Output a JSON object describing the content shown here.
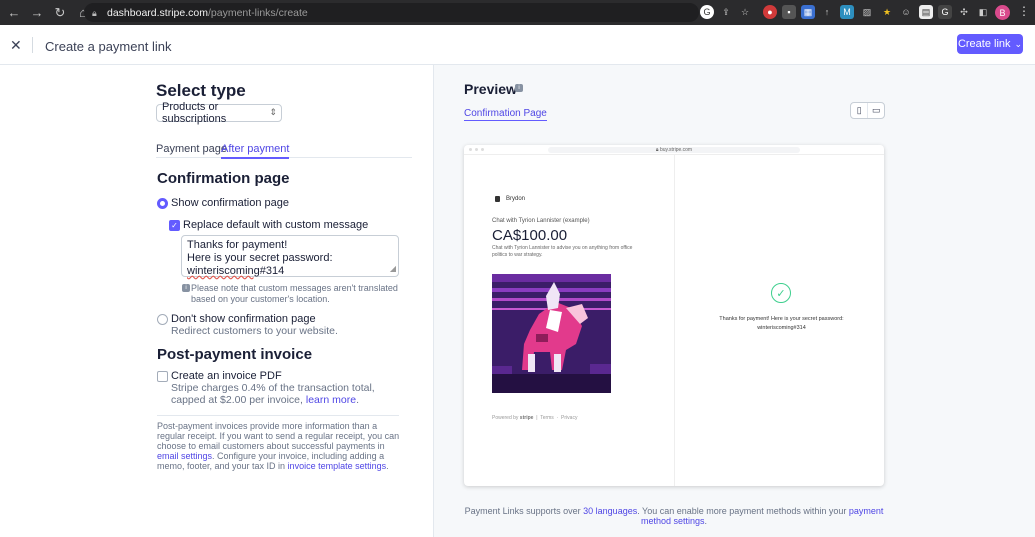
{
  "browser": {
    "url_host": "dashboard.stripe.com",
    "url_path": "/payment-links/create",
    "profile_initial": "B"
  },
  "header": {
    "title": "Create a payment link",
    "create_label": "Create link"
  },
  "left": {
    "select_type_title": "Select type",
    "select_value": "Products or subscriptions",
    "tabs": [
      {
        "label": "Payment page"
      },
      {
        "label": "After payment"
      }
    ],
    "confirmation_title": "Confirmation page",
    "show_confirmation_label": "Show confirmation page",
    "replace_default_label": "Replace default with custom message",
    "message_line1": "Thanks for payment!",
    "message_line2_prefix": "Here is your secret password: ",
    "message_line2_password": "winteriscoming",
    "message_line2_suffix": "#314",
    "note": "Please note that custom messages aren't translated based on your customer's location.",
    "dont_show_label": "Don't show confirmation page",
    "dont_show_sub": "Redirect customers to your website.",
    "post_payment_title": "Post-payment invoice",
    "invoice_pdf_label": "Create an invoice PDF",
    "invoice_pdf_sub": "Stripe charges 0.4% of the transaction total, capped at $2.00 per invoice, ",
    "learn_more": "learn more",
    "footnote_part1": "Post-payment invoices provide more information than a regular receipt. If you want to send a regular receipt, you can choose to email customers about successful payments in ",
    "email_settings": "email settings",
    "footnote_part2": ". Configure your invoice, including adding a memo, footer, and your tax ID in ",
    "invoice_template_settings": "invoice template settings",
    "footnote_part3": "."
  },
  "preview": {
    "title": "Preview",
    "tab": "Confirmation Page",
    "frame_url": "buy.stripe.com",
    "brand": "Brydon",
    "product": "Chat with Tyrion Lannister (example)",
    "price": "CA$100.00",
    "description": "Chat with Tyrion Lannister to advise you on anything from office politics to war strategy.",
    "powered_by": "Powered by",
    "stripe": "stripe",
    "terms": "Terms",
    "privacy": "Privacy",
    "thanks_line1": "Thanks for payment! Here is your secret password:",
    "thanks_line2": "winteriscoming#314",
    "bottom_part1": "Payment Links supports over ",
    "languages": "30 languages",
    "bottom_part2": ". You can enable more payment methods within your ",
    "method_settings": "payment method settings",
    "bottom_part3": "."
  },
  "colors": {
    "accent": "#635bff",
    "success": "#3ecf8e"
  }
}
